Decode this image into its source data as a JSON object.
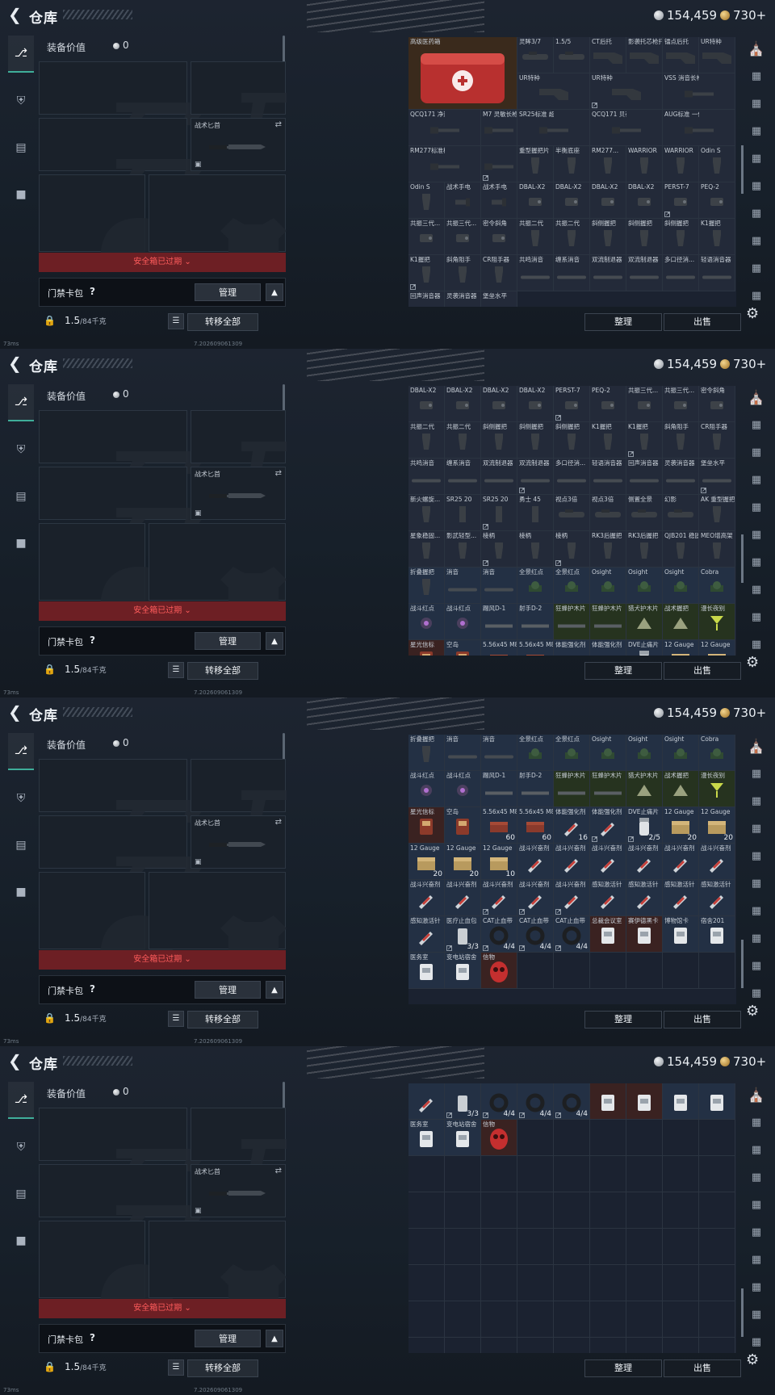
{
  "header": {
    "title": "仓库",
    "silver": "154,459",
    "gold": "730+"
  },
  "left": {
    "equip_label": "装备价值",
    "equip_value": "0",
    "knife_label": "战术匕首",
    "safe_expired": "安全箱已过期",
    "keycard_label": "门禁卡包",
    "help": "?",
    "manage": "管理",
    "weight_value": "1.5",
    "weight_cap": "/84千克",
    "transfer_all": "转移全部"
  },
  "footer": {
    "ping": "73ms",
    "version": "7.202609061309"
  },
  "buttons": {
    "sort": "整理",
    "sell": "出售"
  },
  "icons": {
    "back": "back-arrow-icon",
    "gear": "gear-icon",
    "lock": "lock-icon"
  },
  "colors": {
    "expired_bg": "#6d1f24",
    "expired_text": "#ff5c5c",
    "teal_accent": "#3fae9a"
  },
  "screens": [
    {
      "cells": [
        {
          "n": "高级医药箱",
          "t": "br",
          "i": "medcase",
          "span": 3,
          "r": 2
        },
        {
          "n": "灵眸3/7",
          "i": "scope"
        },
        {
          "n": "1.5/5",
          "i": "scope"
        },
        {
          "n": "CT后托",
          "i": "stock"
        },
        {
          "n": "影袭托芯枪托",
          "i": "stock"
        },
        {
          "n": "镭点后托",
          "i": "stock"
        },
        {
          "n": "UR特种",
          "i": "stock"
        },
        {
          "n": "UR特种",
          "i": "stock",
          "span": 2,
          "r": 1
        },
        {
          "n": "UR特种",
          "i": "stock",
          "span": 2,
          "r": 1,
          "lk": true
        },
        {
          "n": "VSS 消音长枪管",
          "i": "barrel",
          "span": 2,
          "r": 1
        },
        {
          "n": "QCQ171 净逐消音枪管",
          "i": "barrel",
          "span": 2,
          "r": 1
        },
        {
          "n": "M7 灵敏长枪管",
          "i": "barrel"
        },
        {
          "n": "SR25标准 超长枪管",
          "i": "barrel",
          "span": 2,
          "r": 1
        },
        {
          "n": "QCQ171 贝夜枪管组合",
          "i": "barrel",
          "span": 2,
          "r": 1
        },
        {
          "n": "AUG标准 一体消音管",
          "i": "barrel",
          "span": 2,
          "r": 1
        },
        {
          "n": "RM277标准枪管组合",
          "i": "barrel",
          "span": 2,
          "r": 1
        },
        {
          "n": "",
          "i": "barrel",
          "lk": true
        },
        {
          "n": "重型握把片",
          "i": "grip"
        },
        {
          "n": "半衡底座",
          "i": "grip"
        },
        {
          "n": "RM277...",
          "i": "grip"
        },
        {
          "n": "WARRIOR",
          "i": "grip"
        },
        {
          "n": "WARRIOR",
          "i": "grip"
        },
        {
          "n": "Odin S",
          "i": "grip"
        },
        {
          "n": "Odin S",
          "i": "grip"
        },
        {
          "n": "战术手电",
          "i": "flash"
        },
        {
          "n": "战术手电",
          "i": "flash"
        },
        {
          "n": "DBAL-X2",
          "i": "laser"
        },
        {
          "n": "DBAL-X2",
          "i": "laser"
        },
        {
          "n": "DBAL-X2",
          "i": "laser"
        },
        {
          "n": "DBAL-X2",
          "i": "laser"
        },
        {
          "n": "PERST-7",
          "i": "laser",
          "lk": true
        },
        {
          "n": "PEQ-2",
          "i": "laser"
        },
        {
          "n": "共振三代...",
          "i": "laser"
        },
        {
          "n": "共振三代...",
          "i": "laser"
        },
        {
          "n": "密令斜角",
          "i": "laser"
        },
        {
          "n": "共振二代",
          "i": "grip"
        },
        {
          "n": "共振二代",
          "i": "grip"
        },
        {
          "n": "斜侧握把",
          "i": "grip"
        },
        {
          "n": "斜侧握把",
          "i": "grip"
        },
        {
          "n": "斜侧握把",
          "i": "grip"
        },
        {
          "n": "K1握把",
          "i": "grip"
        },
        {
          "n": "K1握把",
          "i": "grip",
          "lk": true
        },
        {
          "n": "斜角阻手",
          "i": "grip"
        },
        {
          "n": "CR阻手器",
          "i": "grip"
        },
        {
          "n": "共鸣消音",
          "i": "sil"
        },
        {
          "n": "缠系消音",
          "i": "sil"
        },
        {
          "n": "双流制退器",
          "i": "sil"
        },
        {
          "n": "双流制退器",
          "i": "sil"
        },
        {
          "n": "多口径消...",
          "i": "sil"
        },
        {
          "n": "轻语消音器",
          "i": "sil"
        },
        {
          "n": "回声消音器",
          "i": "sil"
        },
        {
          "n": "灵袭消音器",
          "i": "sil"
        },
        {
          "n": "堡垒水平",
          "i": "sil"
        }
      ]
    },
    {
      "cells": [
        {
          "n": "DBAL-X2",
          "i": "laser"
        },
        {
          "n": "DBAL-X2",
          "i": "laser"
        },
        {
          "n": "DBAL-X2",
          "i": "laser"
        },
        {
          "n": "DBAL-X2",
          "i": "laser"
        },
        {
          "n": "PERST-7",
          "i": "laser",
          "lk": true
        },
        {
          "n": "PEQ-2",
          "i": "laser"
        },
        {
          "n": "共振三代...",
          "i": "laser"
        },
        {
          "n": "共振三代...",
          "i": "laser"
        },
        {
          "n": "密令斜角",
          "i": "laser"
        },
        {
          "n": "共振二代",
          "i": "grip"
        },
        {
          "n": "共振二代",
          "i": "grip"
        },
        {
          "n": "斜侧握把",
          "i": "grip"
        },
        {
          "n": "斜侧握把",
          "i": "grip"
        },
        {
          "n": "斜侧握把",
          "i": "grip"
        },
        {
          "n": "K1握把",
          "i": "grip"
        },
        {
          "n": "K1握把",
          "i": "grip",
          "lk": true
        },
        {
          "n": "斜角阻手",
          "i": "grip"
        },
        {
          "n": "CR阻手器",
          "i": "grip"
        },
        {
          "n": "共鸣消音",
          "i": "sil"
        },
        {
          "n": "缠系消音",
          "i": "sil"
        },
        {
          "n": "双流制退器",
          "i": "sil"
        },
        {
          "n": "双流制退器",
          "i": "sil",
          "lk": true
        },
        {
          "n": "多口径消...",
          "i": "sil"
        },
        {
          "n": "轻语消音器",
          "i": "sil"
        },
        {
          "n": "回声消音器",
          "i": "sil"
        },
        {
          "n": "灵袭消音器",
          "i": "sil"
        },
        {
          "n": "堡垒水平",
          "i": "sil",
          "lk": true
        },
        {
          "n": "新火螺旋...",
          "i": "grip"
        },
        {
          "n": "SR25 20",
          "i": "mag"
        },
        {
          "n": "SR25 20",
          "i": "mag",
          "lk": true
        },
        {
          "n": "勇士 45",
          "i": "mag"
        },
        {
          "n": "视点3倍",
          "i": "scope"
        },
        {
          "n": "视点3倍",
          "i": "scope"
        },
        {
          "n": "侧置全景",
          "i": "scope"
        },
        {
          "n": "幻影",
          "i": "scope"
        },
        {
          "n": "AK 重型握把",
          "i": "grip"
        },
        {
          "n": "星象稳固...",
          "i": "grip"
        },
        {
          "n": "影武轻型...",
          "i": "grip"
        },
        {
          "n": "棱柄",
          "i": "grip",
          "lk": true
        },
        {
          "n": "棱柄",
          "i": "grip"
        },
        {
          "n": "棱柄",
          "i": "grip",
          "lk": true
        },
        {
          "n": "RK3后握把",
          "i": "grip"
        },
        {
          "n": "RK3后握把",
          "i": "grip"
        },
        {
          "n": "QJB201 稳固后握",
          "i": "grip"
        },
        {
          "n": "MEO增高架",
          "i": "grip"
        },
        {
          "n": "折叠握把",
          "i": "grip",
          "t": "bl"
        },
        {
          "n": "消音",
          "i": "sil",
          "t": "bl"
        },
        {
          "n": "消音",
          "i": "sil",
          "t": "bl"
        },
        {
          "n": "全景红点",
          "i": "dot",
          "t": "bl"
        },
        {
          "n": "全景红点",
          "i": "dot",
          "t": "bl"
        },
        {
          "n": "Osight",
          "i": "dot",
          "t": "bl"
        },
        {
          "n": "Osight",
          "i": "dot",
          "t": "bl"
        },
        {
          "n": "Osight",
          "i": "dot",
          "t": "bl"
        },
        {
          "n": "Cobra",
          "i": "dot",
          "t": "bl"
        },
        {
          "n": "战斗红点",
          "i": "dot2",
          "t": "bl"
        },
        {
          "n": "战斗红点",
          "i": "dot2",
          "t": "bl"
        },
        {
          "n": "踢风D-1",
          "i": "rail",
          "t": "bl"
        },
        {
          "n": "射手D-2",
          "i": "rail",
          "t": "bl"
        },
        {
          "n": "狂蜂护木片",
          "i": "rail",
          "t": "gr"
        },
        {
          "n": "狂蜂护木片",
          "i": "rail",
          "t": "gr"
        },
        {
          "n": "猎犬护木片",
          "i": "tri",
          "t": "gr"
        },
        {
          "n": "战术握把",
          "i": "tri",
          "t": "gr"
        },
        {
          "n": "漫长夜别",
          "i": "glass",
          "t": "gr"
        },
        {
          "n": "星光信标",
          "i": "card",
          "t": "rd"
        },
        {
          "n": "空岛",
          "i": "card",
          "t": "bl"
        },
        {
          "n": "5.56x45 M855A1",
          "i": "ammo",
          "t": "bl"
        },
        {
          "n": "5.56x45 M855A1",
          "i": "ammo",
          "t": "bl"
        },
        {
          "n": "体能强化剂",
          "i": "syringe",
          "t": "bl"
        },
        {
          "n": "体能强化剂",
          "i": "syringe",
          "t": "bl"
        },
        {
          "n": "DVE止痛片",
          "i": "pills",
          "t": "bl"
        },
        {
          "n": "12 Gauge",
          "i": "box",
          "t": "bl"
        },
        {
          "n": "12 Gauge",
          "i": "box",
          "t": "bl"
        }
      ]
    },
    {
      "cells": [
        {
          "n": "折叠握把",
          "i": "grip",
          "t": "bl"
        },
        {
          "n": "消音",
          "i": "sil",
          "t": "bl"
        },
        {
          "n": "消音",
          "i": "sil",
          "t": "bl"
        },
        {
          "n": "全景红点",
          "i": "dot",
          "t": "bl"
        },
        {
          "n": "全景红点",
          "i": "dot",
          "t": "bl"
        },
        {
          "n": "Osight",
          "i": "dot",
          "t": "bl"
        },
        {
          "n": "Osight",
          "i": "dot",
          "t": "bl"
        },
        {
          "n": "Osight",
          "i": "dot",
          "t": "bl"
        },
        {
          "n": "Cobra",
          "i": "dot",
          "t": "bl"
        },
        {
          "n": "战斗红点",
          "i": "dot2",
          "t": "bl"
        },
        {
          "n": "战斗红点",
          "i": "dot2",
          "t": "bl"
        },
        {
          "n": "踢风D-1",
          "i": "rail",
          "t": "bl"
        },
        {
          "n": "射手D-2",
          "i": "rail",
          "t": "bl"
        },
        {
          "n": "狂蜂护木片",
          "i": "rail",
          "t": "gr"
        },
        {
          "n": "狂蜂护木片",
          "i": "rail",
          "t": "gr"
        },
        {
          "n": "猎犬护木片",
          "i": "tri",
          "t": "gr"
        },
        {
          "n": "战术握把",
          "i": "tri",
          "t": "gr"
        },
        {
          "n": "漫长夜别",
          "i": "glass",
          "t": "gr"
        },
        {
          "n": "星光信标",
          "i": "card",
          "t": "rd"
        },
        {
          "n": "空岛",
          "i": "card",
          "t": "bl"
        },
        {
          "n": "5.56x45 M855A1",
          "i": "ammo",
          "t": "bl",
          "c": "60"
        },
        {
          "n": "5.56x45 M855A1",
          "i": "ammo",
          "t": "bl",
          "c": "60"
        },
        {
          "n": "体能强化剂",
          "i": "syringe",
          "t": "bl",
          "c": "16"
        },
        {
          "n": "体能强化剂",
          "i": "syringe",
          "t": "bl",
          "lk": true
        },
        {
          "n": "DVE止痛片",
          "i": "pills",
          "t": "bl",
          "c": "2/5",
          "lk": true
        },
        {
          "n": "12 Gauge",
          "i": "box",
          "t": "bl",
          "c": "20"
        },
        {
          "n": "12 Gauge",
          "i": "box",
          "t": "bl",
          "c": "20"
        },
        {
          "n": "12 Gauge",
          "i": "box",
          "t": "bl",
          "c": "20"
        },
        {
          "n": "12 Gauge",
          "i": "box",
          "t": "bl",
          "c": "20"
        },
        {
          "n": "12 Gauge",
          "i": "box",
          "t": "bl",
          "c": "10"
        },
        {
          "n": "战斗兴奋剂",
          "i": "syringe",
          "t": "bl"
        },
        {
          "n": "战斗兴奋剂",
          "i": "syringe",
          "t": "bl"
        },
        {
          "n": "战斗兴奋剂",
          "i": "syringe",
          "t": "bl"
        },
        {
          "n": "战斗兴奋剂",
          "i": "syringe",
          "t": "bl"
        },
        {
          "n": "战斗兴奋剂",
          "i": "syringe",
          "t": "bl"
        },
        {
          "n": "战斗兴奋剂",
          "i": "syringe",
          "t": "bl"
        },
        {
          "n": "战斗兴奋剂",
          "i": "syringe",
          "t": "bl"
        },
        {
          "n": "战斗兴奋剂",
          "i": "syringe",
          "t": "bl"
        },
        {
          "n": "战斗兴奋剂",
          "i": "syringe",
          "t": "bl",
          "lk": true
        },
        {
          "n": "战斗兴奋剂",
          "i": "syringe",
          "t": "bl",
          "lk": true
        },
        {
          "n": "战斗兴奋剂",
          "i": "syringe",
          "t": "bl",
          "lk": true
        },
        {
          "n": "感知激活针",
          "i": "syringe",
          "t": "bl"
        },
        {
          "n": "感知激活针",
          "i": "syringe",
          "t": "bl"
        },
        {
          "n": "感知激活针",
          "i": "syringe",
          "t": "bl"
        },
        {
          "n": "感知激活针",
          "i": "syringe",
          "t": "bl"
        },
        {
          "n": "感知激活针",
          "i": "syringe",
          "t": "bl"
        },
        {
          "n": "医疗止血包",
          "i": "can",
          "t": "bl",
          "c": "3/3",
          "lk": true
        },
        {
          "n": "CAT止血带",
          "i": "band",
          "t": "bl",
          "c": "4/4",
          "lk": true
        },
        {
          "n": "CAT止血带",
          "i": "band",
          "t": "bl",
          "c": "4/4",
          "lk": true
        },
        {
          "n": "CAT止血带",
          "i": "band",
          "t": "bl",
          "c": "4/4",
          "lk": true
        },
        {
          "n": "总裁会议室",
          "i": "card2",
          "t": "rd"
        },
        {
          "n": "赛伊德黑卡",
          "i": "card2",
          "t": "rd"
        },
        {
          "n": "博物馆卡",
          "i": "card2",
          "t": "bl"
        },
        {
          "n": "宿舍201",
          "i": "card2",
          "t": "bl"
        },
        {
          "n": "医务室",
          "i": "card2",
          "t": "bl"
        },
        {
          "n": "变电站宿舍",
          "i": "card2",
          "t": "bl"
        },
        {
          "n": "信物",
          "i": "mask",
          "t": "rd"
        },
        {
          "n": "",
          "i": "",
          "t": "em"
        },
        {
          "n": "",
          "i": "",
          "t": "em"
        },
        {
          "n": "",
          "i": "",
          "t": "em"
        },
        {
          "n": "",
          "i": "",
          "t": "em"
        },
        {
          "n": "",
          "i": "",
          "t": "em"
        },
        {
          "n": "",
          "i": "",
          "t": "em"
        }
      ]
    },
    {
      "cells": [
        {
          "n": "",
          "i": "syringe",
          "t": "bl"
        },
        {
          "n": "",
          "i": "can",
          "t": "bl",
          "c": "3/3",
          "lk": true
        },
        {
          "n": "",
          "i": "band",
          "t": "bl",
          "c": "4/4",
          "lk": true
        },
        {
          "n": "",
          "i": "band",
          "t": "bl",
          "c": "4/4",
          "lk": true
        },
        {
          "n": "",
          "i": "band",
          "t": "bl",
          "c": "4/4",
          "lk": true
        },
        {
          "n": "",
          "i": "card2",
          "t": "rd"
        },
        {
          "n": "",
          "i": "card2",
          "t": "rd"
        },
        {
          "n": "",
          "i": "card2",
          "t": "bl"
        },
        {
          "n": "",
          "i": "card2",
          "t": "bl"
        },
        {
          "n": "医务室",
          "i": "card2",
          "t": "bl"
        },
        {
          "n": "变电站宿舍",
          "i": "card2",
          "t": "bl"
        },
        {
          "n": "信物",
          "i": "mask",
          "t": "rd"
        }
      ]
    }
  ]
}
